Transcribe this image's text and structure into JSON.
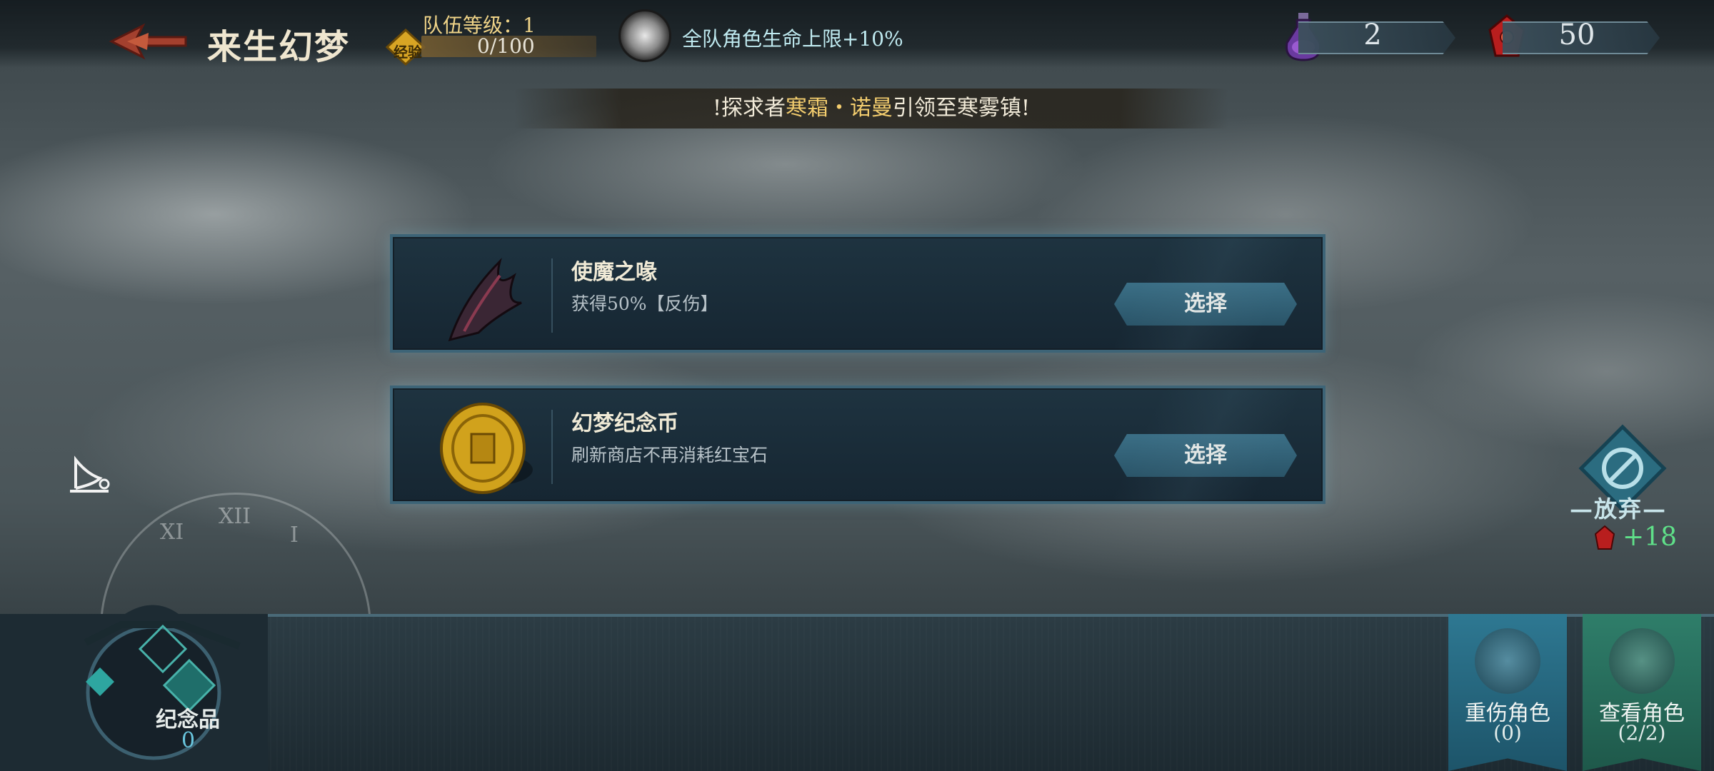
{
  "header": {
    "title": "来生幻梦",
    "team_level_label": "队伍等级：1",
    "exp_badge": "经验",
    "exp_progress": "0/100",
    "exp_fraction": 0,
    "buff_text": "全队角色生命上限+10%"
  },
  "resources": {
    "potion": "2",
    "gem": "50"
  },
  "banner": {
    "prefix": "!探求者",
    "highlight": "寒霜・诺曼",
    "suffix": "引领至寒雾镇!"
  },
  "cards": [
    {
      "name": "使魔之喙",
      "desc": "获得50%【反伤】",
      "button": "选择",
      "icon": "beak-icon"
    },
    {
      "name": "幻梦纪念币",
      "desc": "刷新商店不再消耗红宝石",
      "button": "选择",
      "icon": "coin-icon"
    }
  ],
  "abandon": {
    "label": "放弃",
    "reward": "+18"
  },
  "clock_numerals": [
    "XI",
    "XII",
    "I"
  ],
  "bottom": {
    "souvenir_label": "纪念品",
    "souvenir_count": "0",
    "injured_label": "重伤角色",
    "injured_count": "(0)",
    "view_label": "查看角色",
    "view_count": "(2/2)"
  },
  "colors": {
    "accent_gold": "#f3cd6e",
    "reward_green": "#5fe089",
    "card_border": "#3d6477",
    "button_blue": "#2e7892",
    "button_green": "#2f7e6a"
  }
}
